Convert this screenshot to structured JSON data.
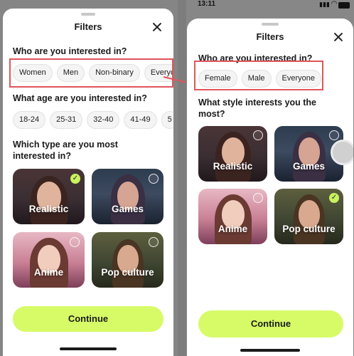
{
  "left": {
    "title": "Filters",
    "q_interest": "Who are you interested in?",
    "interest_chips": [
      "Women",
      "Men",
      "Non-binary",
      "Everyo"
    ],
    "q_age": "What age are you interested in?",
    "age_chips": [
      "18-24",
      "25-31",
      "32-40",
      "41-49",
      "5"
    ],
    "q_type": "Which type are you most interested in?",
    "cards": [
      "Realistic",
      "Games",
      "Anime",
      "Pop culture"
    ],
    "selected_card": "Realistic",
    "continue": "Continue"
  },
  "right": {
    "status_time": "13:11",
    "title": "Filters",
    "q_interest": "Who are you interested in?",
    "interest_chips": [
      "Female",
      "Male",
      "Everyone"
    ],
    "q_style": "What style interests you the most?",
    "cards": [
      "Realistic",
      "Games",
      "Anime",
      "Pop culture"
    ],
    "selected_card": "Pop culture",
    "continue": "Continue"
  },
  "colors": {
    "accent": "#d7fb67",
    "check": "#c9f25f",
    "highlight": "#e0555b"
  },
  "icons": [
    "close-icon",
    "check-icon",
    "arrow-icon",
    "signal-icon",
    "wifi-icon",
    "battery-icon"
  ]
}
